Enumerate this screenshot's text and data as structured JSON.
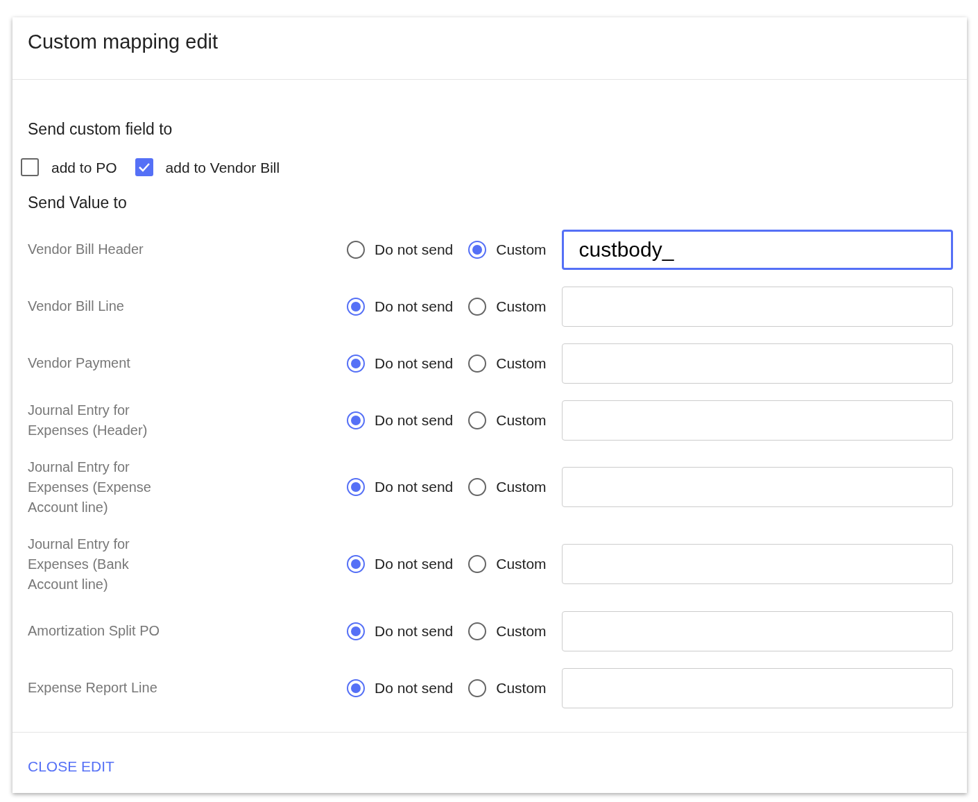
{
  "dialog": {
    "title": "Custom mapping edit"
  },
  "send_field": {
    "heading": "Send custom field to",
    "options": [
      {
        "label": "add to PO",
        "checked": false
      },
      {
        "label": "add to Vendor Bill",
        "checked": true
      }
    ]
  },
  "send_value": {
    "heading": "Send Value to",
    "rows": [
      {
        "label": "Vendor Bill Header",
        "options": [
          {
            "label": "Do not send",
            "selected": false
          },
          {
            "label": "Custom",
            "selected": true
          }
        ],
        "value": "custbody_",
        "focused": true
      },
      {
        "label": "Vendor Bill Line",
        "options": [
          {
            "label": "Do not send",
            "selected": true
          },
          {
            "label": "Custom",
            "selected": false
          }
        ],
        "focused": false
      },
      {
        "label": "Vendor Payment",
        "options": [
          {
            "label": "Do not send",
            "selected": true
          },
          {
            "label": "Custom",
            "selected": false
          }
        ],
        "focused": false
      },
      {
        "label": "Journal Entry for Expenses (Header)",
        "options": [
          {
            "label": "Do not send",
            "selected": true
          },
          {
            "label": "Custom",
            "selected": false
          }
        ],
        "focused": false
      },
      {
        "label": "Journal Entry for Expenses (Expense Account line)",
        "options": [
          {
            "label": "Do not send",
            "selected": true
          },
          {
            "label": "Custom",
            "selected": false
          }
        ],
        "focused": false
      },
      {
        "label": "Journal Entry for Expenses (Bank Account line)",
        "options": [
          {
            "label": "Do not send",
            "selected": true
          },
          {
            "label": "Custom",
            "selected": false
          }
        ],
        "focused": false
      },
      {
        "label": "Amortization Split PO",
        "options": [
          {
            "label": "Do not send",
            "selected": true
          },
          {
            "label": "Custom",
            "selected": false
          }
        ],
        "focused": false
      },
      {
        "label": "Expense Report Line",
        "options": [
          {
            "label": "Do not send",
            "selected": true
          },
          {
            "label": "Custom",
            "selected": false
          }
        ],
        "focused": false
      }
    ]
  },
  "footer": {
    "button": "CLOSE EDIT"
  }
}
